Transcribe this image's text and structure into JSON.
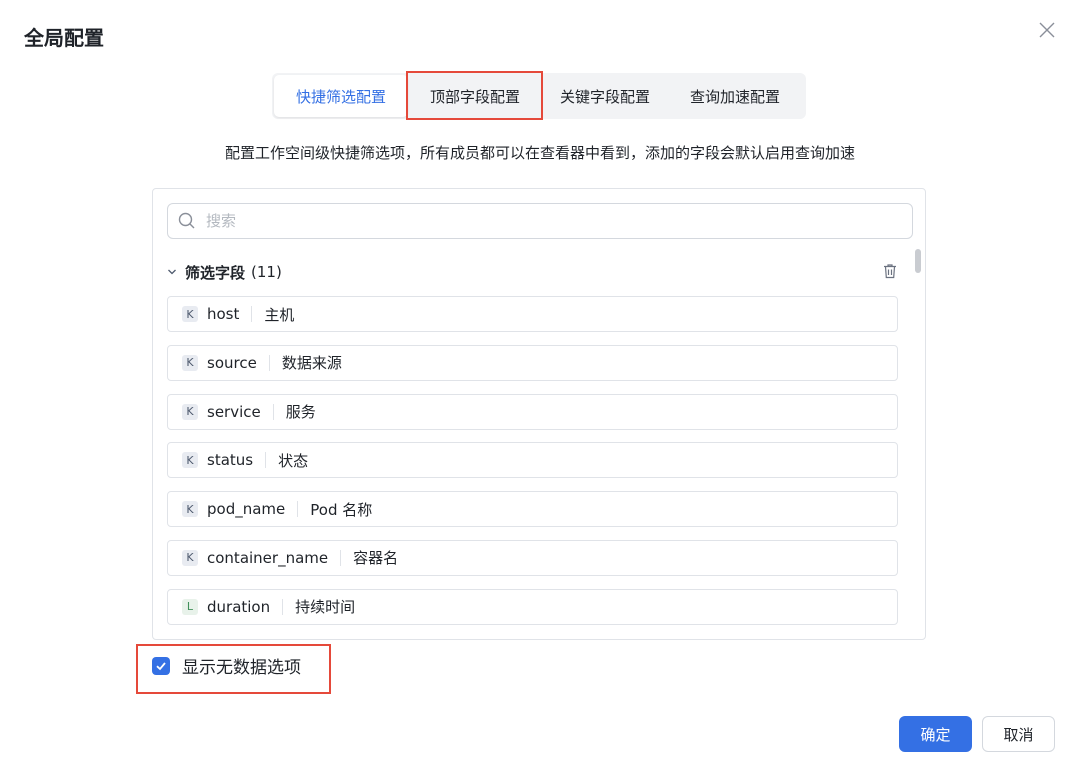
{
  "dialog": {
    "title": "全局配置"
  },
  "tabs": [
    {
      "label": "快捷筛选配置",
      "active": true
    },
    {
      "label": "顶部字段配置",
      "active": false,
      "highlighted": true
    },
    {
      "label": "关键字段配置",
      "active": false
    },
    {
      "label": "查询加速配置",
      "active": false
    }
  ],
  "description": "配置工作空间级快捷筛选项，所有成员都可以在查看器中看到，添加的字段会默认启用查询加速",
  "search": {
    "placeholder": "搜索",
    "value": ""
  },
  "group": {
    "title": "筛选字段",
    "count": "(11)"
  },
  "fields": [
    {
      "type": "K",
      "name": "host",
      "alias": "主机"
    },
    {
      "type": "K",
      "name": "source",
      "alias": "数据来源"
    },
    {
      "type": "K",
      "name": "service",
      "alias": "服务"
    },
    {
      "type": "K",
      "name": "status",
      "alias": "状态"
    },
    {
      "type": "K",
      "name": "pod_name",
      "alias": "Pod 名称"
    },
    {
      "type": "K",
      "name": "container_name",
      "alias": "容器名"
    },
    {
      "type": "L",
      "name": "duration",
      "alias": "持续时间"
    }
  ],
  "show_empty": {
    "label": "显示无数据选项",
    "checked": true
  },
  "buttons": {
    "ok": "确定",
    "cancel": "取消"
  },
  "colors": {
    "accent": "#3470e4",
    "highlight": "#e5493a"
  }
}
